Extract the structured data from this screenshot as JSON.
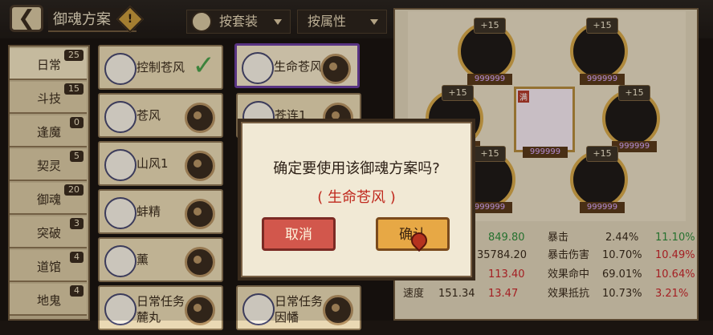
{
  "header": {
    "title": "御魂方案",
    "warning": "!",
    "filter_set": "按套装",
    "filter_attr": "按属性"
  },
  "nav": [
    {
      "label": "日常",
      "count": "25"
    },
    {
      "label": "斗技",
      "count": "15"
    },
    {
      "label": "逢魔",
      "count": "0"
    },
    {
      "label": "契灵",
      "count": "5"
    },
    {
      "label": "御魂",
      "count": "20"
    },
    {
      "label": "突破",
      "count": "3"
    },
    {
      "label": "道馆",
      "count": "4"
    },
    {
      "label": "地鬼",
      "count": "4"
    }
  ],
  "list_left": [
    {
      "name": "控制苍风"
    },
    {
      "name": "苍风"
    },
    {
      "name": "山风1"
    },
    {
      "name": "蚌精"
    },
    {
      "name": "薰"
    },
    {
      "name": "日常任务\n麓丸"
    }
  ],
  "list_right": [
    {
      "name": "生命苍风"
    },
    {
      "name": "苍连1"
    },
    {
      "name": "日常任务\n因幡"
    }
  ],
  "slots": {
    "plus": "+15",
    "score": "999999"
  },
  "portrait": {
    "tag": "满"
  },
  "stats": [
    {
      "base": "849.80",
      "k": "暴击",
      "v": "2.44%",
      "d": "11.10%",
      "dclass": "green"
    },
    {
      "base": "35784.20",
      "k": "暴击伤害",
      "v": "10.70%",
      "d": "10.49%",
      "dclass": "red"
    },
    {
      "base": "113.40",
      "k": "效果命中",
      "v": "69.01%",
      "d": "10.64%",
      "dclass": "red"
    },
    {
      "label": "速度",
      "base": "151.34",
      "extra": "13.47",
      "k": "效果抵抗",
      "v": "10.73%",
      "d": "3.21%",
      "dclass": "red"
    }
  ],
  "dialog": {
    "question": "确定要使用该御魂方案吗?",
    "name": "( 生命苍风 )",
    "cancel": "取消",
    "confirm": "确认"
  }
}
